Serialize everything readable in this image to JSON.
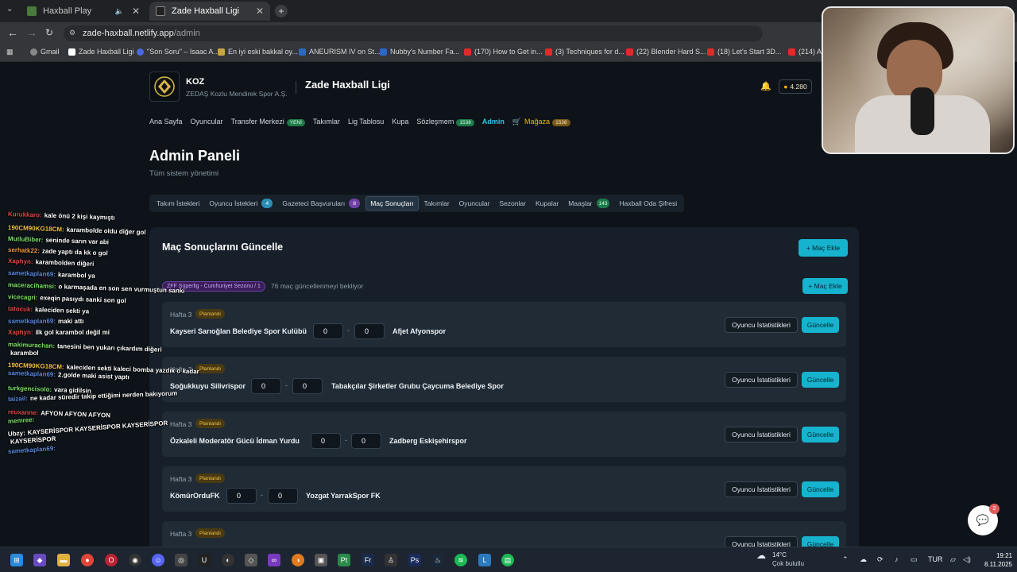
{
  "browser": {
    "tabs": [
      {
        "label": "Haxball Play"
      },
      {
        "label": "Zade Haxball Ligi"
      }
    ],
    "url_host": "zade-haxball.netlify.app",
    "url_path": "/admin",
    "bookmarks": [
      "Gmail",
      "Zade Haxball Ligi",
      "\"Son Soru\" – Isaac A...",
      "En iyi eski bakkal oy...",
      "ANEURISM IV on St...",
      "Nubby's Number Fa...",
      "(170) How to Get in...",
      "(3) Techniques for d...",
      "(22) Blender Hard S...",
      "(18) Let's Start 3D...",
      "(214) Av"
    ]
  },
  "header": {
    "club_name": "KOZ",
    "club_sub": "ZEDAŞ Kozlu Mendirek Spor A.Ş.",
    "league": "Zade Haxball Ligi",
    "coins": "4.280"
  },
  "nav": {
    "home": "Ana Sayfa",
    "players": "Oyuncular",
    "transfer": "Transfer Merkezi",
    "transfer_badge": "YENİ",
    "teams": "Takımlar",
    "table": "Lig Tablosu",
    "cup": "Kupa",
    "contract": "Sözleşmem",
    "contract_badge": "1538",
    "admin": "Admin",
    "shop": "Mağaza",
    "shop_badge": "1538"
  },
  "page": {
    "title": "Admin Paneli",
    "subtitle": "Tüm sistem yönetimi"
  },
  "admin_tabs": [
    {
      "label": "Takım İstekleri",
      "count": ""
    },
    {
      "label": "Oyuncu İstekleri",
      "count": "4"
    },
    {
      "label": "Gazeteci Başvuruları",
      "count": "8"
    },
    {
      "label": "Maç Sonuçları",
      "count": ""
    },
    {
      "label": "Takımlar",
      "count": ""
    },
    {
      "label": "Oyuncular",
      "count": ""
    },
    {
      "label": "Sezonlar",
      "count": ""
    },
    {
      "label": "Kupalar",
      "count": ""
    },
    {
      "label": "Maaşlar",
      "count": "143"
    },
    {
      "label": "Haxball Oda Şifresi",
      "count": ""
    }
  ],
  "panel": {
    "title": "Maç Sonuçlarını Güncelle",
    "add_match": "+ Maç Ekle",
    "add_match_2": "+ Maç Ekle",
    "season": "ZFF Süperlig - Cumhuriyet Sezonu / 1",
    "pending": "76 maç güncellenmeyi bekliyor",
    "stats_label": "Oyuncu İstatistikleri",
    "update_label": "Güncelle"
  },
  "matches": [
    {
      "week": "Hafta 3",
      "status": "Planlandı",
      "home": "Kayseri Sarıoğlan Belediye Spor Kulübü",
      "home_score": "0",
      "away_score": "0",
      "away": "Afjet Afyonspor"
    },
    {
      "week": "Hafta 3",
      "status": "Planlandı",
      "home": "Soğukkuyu Silivrispor",
      "home_score": "0",
      "away_score": "0",
      "away": "Tabakçılar Şirketler Grubu Çaycuma Belediye Spor"
    },
    {
      "week": "Hafta 3",
      "status": "Planlandı",
      "home": "Özkaleli Moderatör Gücü İdman Yurdu",
      "home_score": "0",
      "away_score": "0",
      "away": "Zadberg Eskişehirspor"
    },
    {
      "week": "Hafta 3",
      "status": "Planlandı",
      "home": "KömürOrduFK",
      "home_score": "0",
      "away_score": "0",
      "away": "Yozgat YarrakSpor FK"
    },
    {
      "week": "Hafta 3",
      "status": "Planlandı",
      "home": "",
      "home_score": "",
      "away_score": "",
      "away": ""
    }
  ],
  "chat": [
    {
      "user": "Kurukkaro:",
      "msg": "kale önü 2 kişi kaymıştı",
      "color": "#e04a4a"
    },
    {
      "user": "190CM90KG18CM:",
      "msg": "karambolde oldu diğer gol",
      "color": "#f5c542"
    },
    {
      "user": "MutluBiber:",
      "msg": "seninde sarın var abi",
      "color": "#7ee06a"
    },
    {
      "user": "serhatk22:",
      "msg": "zade yaptı da kk o gol",
      "color": "#f59a42"
    },
    {
      "user": "Xaphyn:",
      "msg": "karambolden diğeri",
      "color": "#e04a4a"
    },
    {
      "user": "sametkaplan69:",
      "msg": "karambol ya",
      "color": "#5a8ae0"
    },
    {
      "user": "maceracihamsi:",
      "msg": "o karmaşada en son sen vurmuştun sanki",
      "color": "#7ee06a"
    },
    {
      "user": "vicecagri:",
      "msg": "exeqin pasıydı sanki son gol",
      "color": "#7ee06a"
    },
    {
      "user": "tatocuk:",
      "msg": "kaleciden sekti ya",
      "color": "#e04a4a"
    },
    {
      "user": "sametkaplan69:",
      "msg": "maki attı",
      "color": "#5a8ae0"
    },
    {
      "user": "Xaphyn:",
      "msg": "ilk gol karambol değil mi",
      "color": "#e04a4a"
    },
    {
      "user": "makimurachan:",
      "msg": "tanesini ben yukarı çıkardım diğeri",
      "color": "#7ee06a"
    },
    {
      "user": "",
      "msg": "karambol",
      "color": "#ffffff"
    },
    {
      "user": "190CM90KG18CM:",
      "msg": "kaleciden sekti kaleci bomba yazdık o kadar",
      "color": "#f5c542"
    },
    {
      "user": "sametkaplan69:",
      "msg": "2.golde maki asist yaptı",
      "color": "#5a8ae0"
    },
    {
      "user": "turkgencisolo:",
      "msg": "vara gidilsin",
      "color": "#7ee06a"
    },
    {
      "user": "taizail:",
      "msg": "ne kadar süredir takip ettiğimi nerden bakıyorum",
      "color": "#5a8ae0"
    },
    {
      "user": "reuxanne:",
      "msg": "AFYON AFYON AFYON",
      "color": "#e04a4a"
    },
    {
      "user": "memree:",
      "msg": "",
      "color": "#7ee06a"
    },
    {
      "user": "Ubzy:",
      "msg": "KAYSERİSPOR KAYSERİSPOR KAYSERİSPOR",
      "color": "#ffffff"
    },
    {
      "user": "",
      "msg": "KAYSERİSPOR",
      "color": "#ffffff"
    },
    {
      "user": "sametkaplan69:",
      "msg": "",
      "color": "#5a8ae0"
    }
  ],
  "help": {
    "count": "2"
  },
  "taskbar": {
    "weather_temp": "14°C",
    "weather_desc": "Çok bulutlu",
    "lang": "TUR",
    "time": "19:21",
    "date": "8.11.2025"
  }
}
